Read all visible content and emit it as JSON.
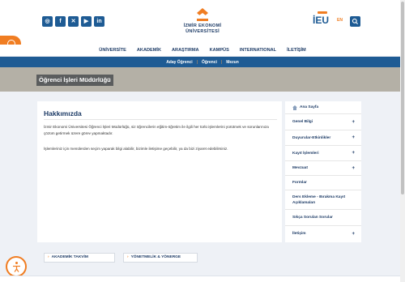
{
  "header": {
    "social": [
      "◎",
      "f",
      "✕",
      "▶",
      "in"
    ],
    "logo_line1": "İZMİR EKONOMİ",
    "logo_line2": "ÜNİVERSİTESİ",
    "ieu_logo": "İEU",
    "lang": "EN"
  },
  "nav": {
    "items": [
      "ÜNİVERSİTE",
      "AKADEMİK",
      "ARAŞTIRMA",
      "KAMPÜS",
      "INTERNATIONAL",
      "İLETİŞİM"
    ]
  },
  "subnav": {
    "items": [
      "Aday Öğrenci",
      "Öğrenci",
      "Mezun"
    ],
    "separator": "|"
  },
  "banner": {
    "title": "Öğrenci İşleri Müdürlüğü"
  },
  "content": {
    "title": "Hakkımızda",
    "paragraph1": "İzmir Ekonomi Üniversitesi Öğrenci İşleri Müdürlüğü, siz öğrencilerin eğitim-öğretim ile ilgili her türlü işlemlerini yürütmek ve sorunlarınıza çözüm getirmek üzere görev yapmaktadır.",
    "paragraph2": "İşlemleriniz için menülerden seçim yaparak bilgi alabilir, bizimle iletişime geçebilir, ya da bizi ziyaret edebilirsiniz."
  },
  "sidebar": {
    "items": [
      {
        "label": "Ana Sayfa",
        "plus": ""
      },
      {
        "label": "Genel Bilgi",
        "plus": "+"
      },
      {
        "label": "Duyurular-Etkinlikler",
        "plus": "+"
      },
      {
        "label": "Kayıt İşlemleri",
        "plus": "+"
      },
      {
        "label": "Mevzuat",
        "plus": "+"
      },
      {
        "label": "Formlar",
        "plus": ""
      },
      {
        "label": "Ders Ekleme - Bırakma Kayıt Açıklamaları",
        "plus": ""
      },
      {
        "label": "Sıkça Sorulan Sorular",
        "plus": ""
      },
      {
        "label": "İletişim",
        "plus": "+"
      }
    ]
  },
  "buttons": {
    "academic_calendar": "AKADEMİK TAKVİM",
    "regulations": "YÖNETMELİK & YÖNERGE",
    "chevron": "›"
  },
  "colors": {
    "brand_blue": "#1e5b94",
    "brand_navy": "#1d3b66",
    "accent_orange": "#f07d22",
    "content_bg": "#eef1f6"
  }
}
